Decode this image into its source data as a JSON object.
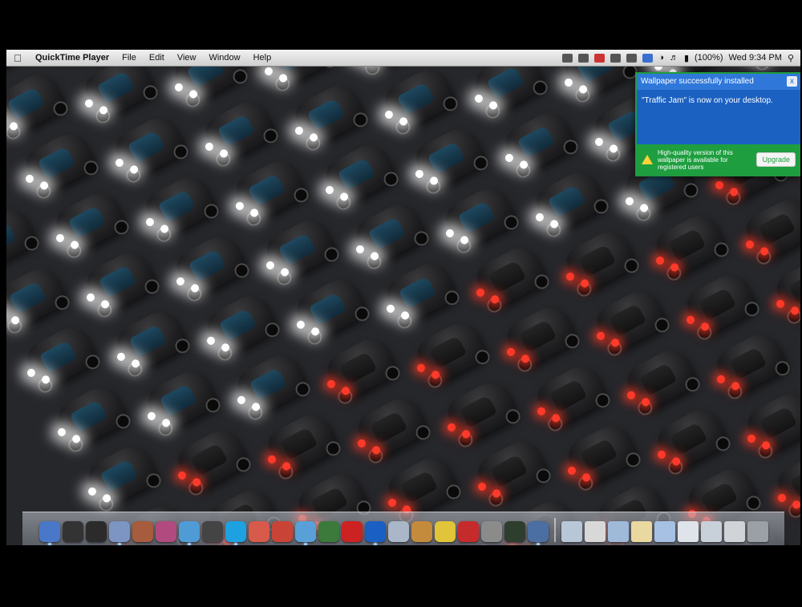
{
  "menubar": {
    "apple": "",
    "app_name": "QuickTime Player",
    "items": [
      "File",
      "Edit",
      "View",
      "Window",
      "Help"
    ],
    "clock": "Wed 9:34 PM",
    "battery": "(100%)",
    "search_icon": "spotlight-icon"
  },
  "notification": {
    "title": "Wallpaper successfully installed",
    "close": "x",
    "message": "\"Traffic Jam\" is now on your desktop.",
    "footer_text": "High-quality version of this wallpaper is available for registered users",
    "button": "Upgrade",
    "colors": {
      "border": "#1f9b3e",
      "body": "#1b61c2",
      "footer": "#1e9e3f"
    }
  },
  "dock": {
    "apps": [
      {
        "name": "finder",
        "color": "#4a78c8",
        "running": true
      },
      {
        "name": "dashboard",
        "color": "#333333",
        "running": false
      },
      {
        "name": "time-machine",
        "color": "#2b2b2b",
        "running": false
      },
      {
        "name": "preview",
        "color": "#7c95c2",
        "running": true
      },
      {
        "name": "address-book",
        "color": "#a65c3d",
        "running": false
      },
      {
        "name": "photo-booth",
        "color": "#b14a7e",
        "running": false
      },
      {
        "name": "safari",
        "color": "#4f9bd6",
        "running": true
      },
      {
        "name": "candle",
        "color": "#444444",
        "running": false
      },
      {
        "name": "skype",
        "color": "#1ea1e0",
        "running": true
      },
      {
        "name": "ical",
        "color": "#d85a4a",
        "running": false
      },
      {
        "name": "chrome",
        "color": "#c94437",
        "running": false
      },
      {
        "name": "itunes",
        "color": "#5aa0d8",
        "running": true
      },
      {
        "name": "iphoto",
        "color": "#3b7a3b",
        "running": false
      },
      {
        "name": "photo-strip",
        "color": "#cc2222",
        "running": false
      },
      {
        "name": "quicktime",
        "color": "#1a5fc4",
        "running": true
      },
      {
        "name": "mail",
        "color": "#a9b7c9",
        "running": false
      },
      {
        "name": "box",
        "color": "#c58b3c",
        "running": false
      },
      {
        "name": "lightbulb",
        "color": "#e0c43a",
        "running": false
      },
      {
        "name": "acrobat",
        "color": "#c62b2b",
        "running": false
      },
      {
        "name": "system-preferences",
        "color": "#8b8b8b",
        "running": false
      },
      {
        "name": "activity-monitor",
        "color": "#2e3e2e",
        "running": false
      },
      {
        "name": "screen",
        "color": "#4b6ea3",
        "running": true
      }
    ],
    "stacks": [
      {
        "name": "folder-1",
        "color": "#b8c7d8"
      },
      {
        "name": "folder-2",
        "color": "#d8d8d8"
      },
      {
        "name": "folder-3",
        "color": "#9fb9d9"
      },
      {
        "name": "folder-4",
        "color": "#e9d8a0"
      },
      {
        "name": "folder-5",
        "color": "#a7c1e4"
      },
      {
        "name": "folder-6",
        "color": "#dfe4ea"
      },
      {
        "name": "folder-7",
        "color": "#c8d0da"
      },
      {
        "name": "folder-8",
        "color": "#d0d4d8"
      },
      {
        "name": "trash",
        "color": "#9aa0a6"
      }
    ]
  }
}
